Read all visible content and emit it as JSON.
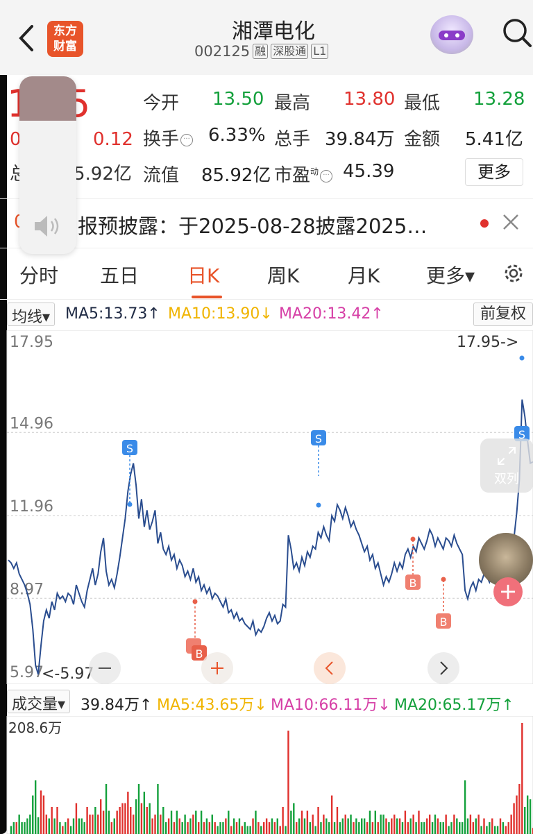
{
  "header": {
    "title": "湘潭电化",
    "code": "002125",
    "tags": [
      "融",
      "深股通",
      "L1"
    ],
    "logo_text": [
      "东方",
      "财富"
    ]
  },
  "quote": {
    "price": "13.65",
    "price_visible": "1  65",
    "change_pct_visible": "0",
    "change": "0.12",
    "mcap_label_visible": "总",
    "mcap_value_visible": "5.92亿",
    "open_label": "今开",
    "open": "13.50",
    "high_label": "最高",
    "high": "13.80",
    "low_label": "最低",
    "low": "13.28",
    "turnover_label": "换手",
    "turnover": "6.33%",
    "volume_label": "总手",
    "volume": "39.84万",
    "amount_label": "金额",
    "amount": "5.41亿",
    "float_label": "流值",
    "float_value": "85.92亿",
    "pe_label": "市盈",
    "pe_sup": "动",
    "pe": "45.39",
    "more_label": "更多"
  },
  "notice": {
    "prefix_visible": "0",
    "text": "报预披露：于2025-08-28披露2025…"
  },
  "tabs": [
    {
      "label": "分时",
      "active": false
    },
    {
      "label": "五日",
      "active": false
    },
    {
      "label": "日K",
      "active": true
    },
    {
      "label": "周K",
      "active": false
    },
    {
      "label": "月K",
      "active": false
    },
    {
      "label": "更多▾",
      "active": false
    }
  ],
  "ma_legend": {
    "selector": "均线▾",
    "ma5": "MA5:13.73↑",
    "ma10": "MA10:13.90↓",
    "ma20": "MA20:13.42↑",
    "adjust": "前复权",
    "colors": {
      "ma5": "#1f2a44",
      "ma10": "#f0b400",
      "ma20": "#d63fa6"
    }
  },
  "volume_legend": {
    "selector": "成交量▾",
    "value": "39.84万↑",
    "ma5": "MA5:43.65万↓",
    "ma10": "MA10:66.11万↓",
    "ma20": "MA20:65.17万↑",
    "max_label": "208.6万",
    "colors": {
      "ma5": "#f0b400",
      "ma10": "#d63fa6",
      "ma20": "#13a03b"
    }
  },
  "side": {
    "dual_label": "双列"
  },
  "chart_data": {
    "type": "line",
    "y_ticks": [
      "17.95",
      "14.96",
      "11.96",
      "8.97",
      "5.97"
    ],
    "ylim": [
      5.97,
      17.95
    ],
    "max_marker": "17.95->",
    "min_marker": "<-5.97",
    "series": [
      {
        "values": [
          10.1,
          10.0,
          9.8,
          10.0,
          9.6,
          9.4,
          9.2,
          8.9,
          8.5,
          7.6,
          6.3,
          5.97,
          7.0,
          7.9,
          8.3,
          8.0,
          8.6,
          8.3,
          8.9,
          8.7,
          8.8,
          8.6,
          8.9,
          8.8,
          8.5,
          9.2,
          8.9,
          8.6,
          8.4,
          9.0,
          9.4,
          9.8,
          9.2,
          9.6,
          10.4,
          10.9,
          9.7,
          9.2,
          9.4,
          9.1,
          9.6,
          10.2,
          10.9,
          11.6,
          12.6,
          13.2,
          13.6,
          12.8,
          11.6,
          12.3,
          11.3,
          11.9,
          11.2,
          11.5,
          11.9,
          10.7,
          11.1,
          10.5,
          10.3,
          10.6,
          10.1,
          10.3,
          9.8,
          10.1,
          9.9,
          9.5,
          9.7,
          9.4,
          9.8,
          9.3,
          9.5,
          9.0,
          9.2,
          8.9,
          9.1,
          8.7,
          8.9,
          8.8,
          8.6,
          8.4,
          8.7,
          8.2,
          8.3,
          8.0,
          8.2,
          7.9,
          8.0,
          7.8,
          7.7,
          7.6,
          7.9,
          7.4,
          7.6,
          7.5,
          7.7,
          8.0,
          8.2,
          7.9,
          8.1,
          7.8,
          7.9,
          8.5,
          8.4,
          11.0,
          10.5,
          9.8,
          10.0,
          9.7,
          10.2,
          9.9,
          10.4,
          10.2,
          10.6,
          10.5,
          11.1,
          10.9,
          11.3,
          11.0,
          10.8,
          11.7,
          11.5,
          12.1,
          11.9,
          11.6,
          12.0,
          11.7,
          11.3,
          11.5,
          11.2,
          11.0,
          10.7,
          10.4,
          10.6,
          10.1,
          10.3,
          9.8,
          10.0,
          9.6,
          9.2,
          9.5,
          9.3,
          9.6,
          10.0,
          9.7,
          10.0,
          9.8,
          10.3,
          10.5,
          10.2,
          10.6,
          10.4,
          10.9,
          10.7,
          10.5,
          10.8,
          11.2,
          11.0,
          10.6,
          10.9,
          10.7,
          10.5,
          10.9,
          10.8,
          10.6,
          11.0,
          10.7,
          10.5,
          10.3,
          9.0,
          8.7,
          9.1,
          9.3,
          9.0,
          9.4,
          9.3,
          9.6,
          9.5,
          9.3,
          9.6,
          9.5,
          9.4,
          9.7,
          9.5,
          9.6,
          9.8,
          10.2,
          10.9,
          11.8,
          13.0,
          15.9,
          15.3,
          14.4,
          13.6,
          13.65
        ]
      }
    ]
  }
}
